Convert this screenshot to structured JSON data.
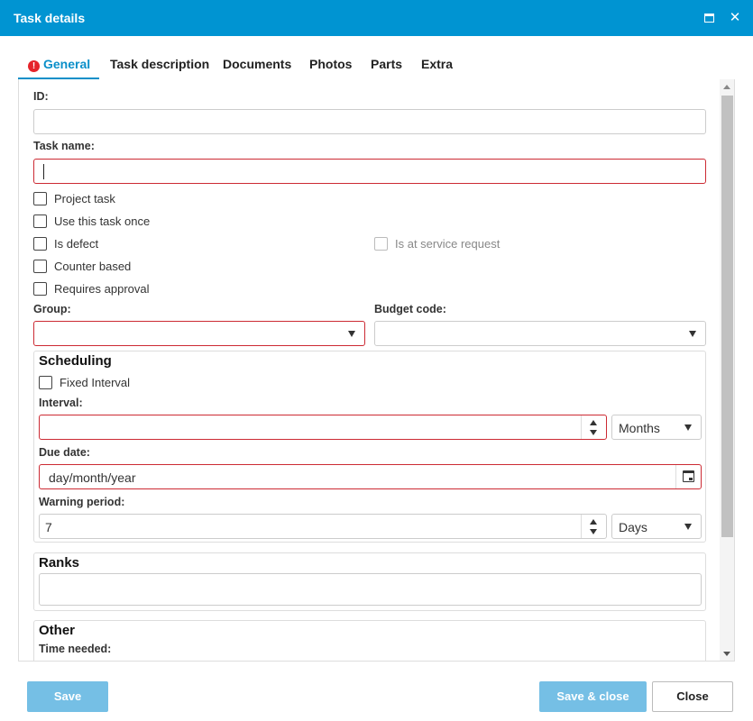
{
  "window": {
    "title": "Task details"
  },
  "tabs": [
    {
      "label": "General"
    },
    {
      "label": "Task description"
    },
    {
      "label": "Documents"
    },
    {
      "label": "Photos"
    },
    {
      "label": "Parts"
    },
    {
      "label": "Extra"
    }
  ],
  "general": {
    "id_label": "ID:",
    "id_value": "",
    "task_name_label": "Task name:",
    "task_name_value": "",
    "checkboxes": {
      "project_task": "Project task",
      "use_once": "Use this task once",
      "is_defect": "Is defect",
      "service_request": "Is at service request",
      "counter_based": "Counter based",
      "requires_approval": "Requires approval"
    },
    "group_label": "Group:",
    "group_value": "",
    "budget_label": "Budget code:",
    "budget_value": ""
  },
  "scheduling": {
    "title": "Scheduling",
    "fixed_interval": "Fixed Interval",
    "interval_label": "Interval:",
    "interval_value": "",
    "interval_unit": "Months",
    "due_date_label": "Due date:",
    "due_date_placeholder": "day/month/year",
    "warning_label": "Warning period:",
    "warning_value": "7",
    "warning_unit": "Days"
  },
  "ranks": {
    "title": "Ranks"
  },
  "other": {
    "title": "Other",
    "time_needed_label": "Time needed:"
  },
  "footer": {
    "save": "Save",
    "save_close": "Save & close",
    "close": "Close"
  },
  "colors": {
    "accent": "#0094d2",
    "required_border": "#cc2a33",
    "primary_button": "#75bfe5"
  }
}
